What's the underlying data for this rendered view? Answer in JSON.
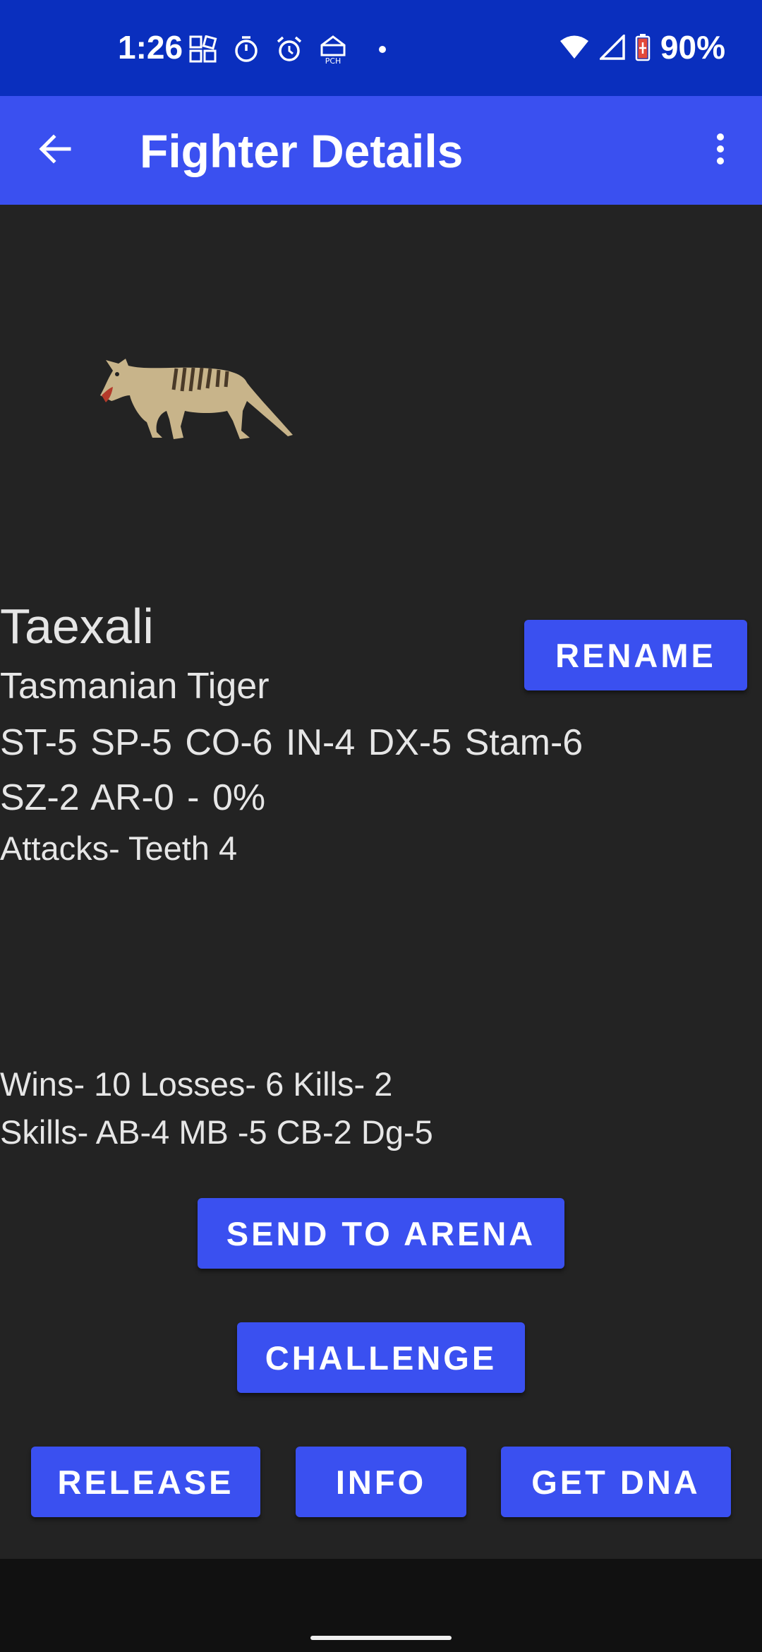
{
  "status_bar": {
    "time": "1:26",
    "icons": [
      "widgets-icon",
      "timer-icon",
      "alarm-icon",
      "pch-icon",
      "dot-icon"
    ],
    "pch_label": "PCH",
    "battery": "90%"
  },
  "app_bar": {
    "title": "Fighter Details"
  },
  "fighter": {
    "name": "Taexali",
    "species": "Tasmanian Tiger",
    "stats_line1": "ST-5 SP-5 CO-6 IN-4 DX-5 Stam-6",
    "stats_line2": "SZ-2 AR-0 - 0%",
    "attacks": "Attacks- Teeth 4",
    "record": "Wins- 10 Losses- 6 Kills- 2",
    "skills": "Skills- AB-4 MB -5 CB-2 Dg-5"
  },
  "buttons": {
    "rename": "RENAME",
    "send_to_arena": "SEND TO ARENA",
    "challenge": "CHALLENGE",
    "release": "RELEASE",
    "info": "INFO",
    "get_dna": "GET DNA"
  },
  "colors": {
    "status_bar": "#0a2fbe",
    "app_bar": "#3a50f0",
    "button": "#3a50f0",
    "background": "#232323"
  }
}
